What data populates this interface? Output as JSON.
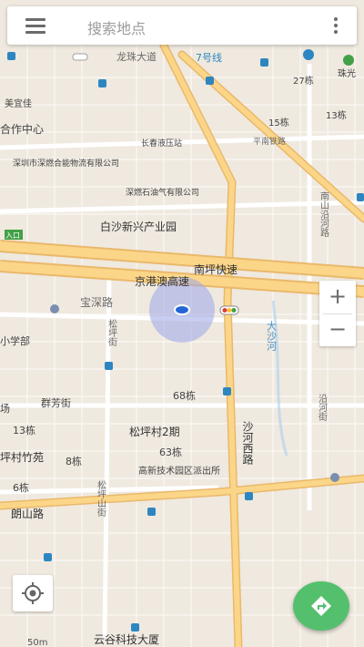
{
  "search": {
    "placeholder": "搜索地点"
  },
  "zoom": {
    "in_label": "+",
    "out_label": "−"
  },
  "scale_label": "50m",
  "roads": {
    "longzhu": "龙珠大道",
    "line7": "7号线",
    "pingnan_rail": "平南铁路",
    "nanping": "南坪快速",
    "jinggang": "京港澳高速",
    "baoshen": "宝深路",
    "songping_st": "松坪街",
    "shahe_west": "沙河西路",
    "langshan": "朗山路",
    "songping_shan": "松坪山街",
    "nanshan_yanhe": "南山沿河路",
    "yanhe_st": "沿河街",
    "dasha_river": "大沙河"
  },
  "places": {
    "top_partial": "...",
    "meiyi": "美宜佳",
    "cooperation": "合作中心",
    "shenzhen_company": "深圳市深燃合能物流有限公司",
    "changchun": "长春液压站",
    "gas_company": "深燃石油气有限公司",
    "baisha": "白沙新兴产业园",
    "entrance": "入口",
    "primary": "小学部",
    "qunfang": "群芳街",
    "songping2": "松坪村2期",
    "songping_garden": "坪村竹苑",
    "high_school": "高新技术园区派出所",
    "tech_tower": "云谷科技大厦",
    "field": "场",
    "zhuguang": "珠光",
    "b27": "27栋",
    "b15": "15栋",
    "b13": "13栋",
    "b13b": "13栋",
    "b68": "68栋",
    "b63": "63栋",
    "b8": "8栋",
    "b6": "6栋",
    "b8b": "8栋"
  },
  "colors": {
    "land": "#efe9df",
    "highway": "#fbd689",
    "highway_edge": "#eab86a",
    "road": "#ffffff",
    "location": "#2566d6",
    "route_button": "#54c06d"
  }
}
